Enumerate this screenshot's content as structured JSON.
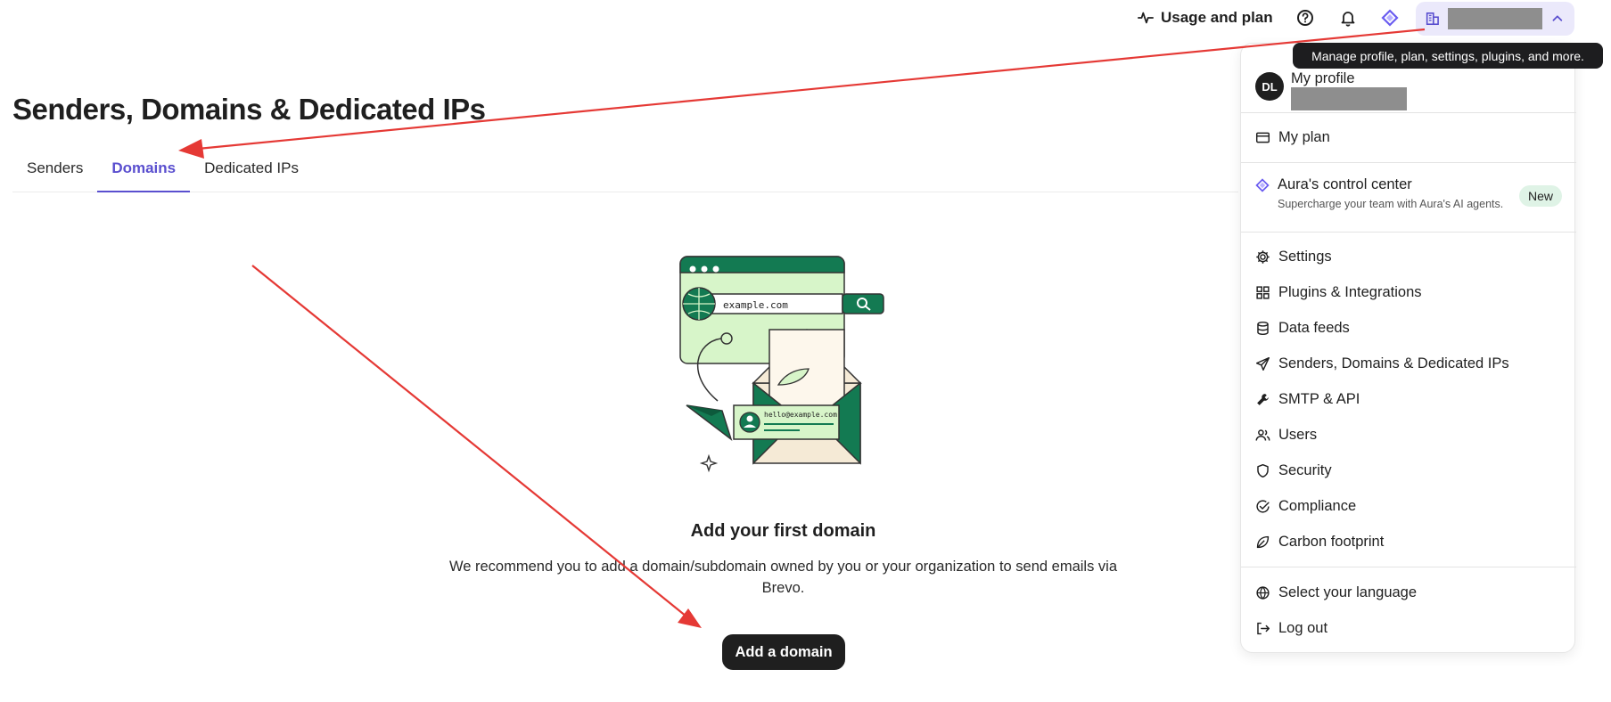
{
  "topbar": {
    "usage_label": "Usage and plan",
    "icons": [
      "pulse-icon",
      "help-icon",
      "bell-icon",
      "aura-diamond-icon",
      "building-icon",
      "chevron-up-icon"
    ]
  },
  "tooltip": "Manage profile, plan, settings, plugins, and more.",
  "page": {
    "title": "Senders, Domains & Dedicated IPs",
    "tabs": [
      {
        "label": "Senders",
        "active": false
      },
      {
        "label": "Domains",
        "active": true
      },
      {
        "label": "Dedicated IPs",
        "active": false
      }
    ]
  },
  "illustration": {
    "url_text": "example.com",
    "email_text": "hello@example.com"
  },
  "empty_state": {
    "title": "Add your first domain",
    "description": "We recommend you to add a domain/subdomain owned by you or your organization to send emails via Brevo.",
    "button": "Add a domain"
  },
  "menu": {
    "avatar_initials": "DL",
    "profile_label": "My profile",
    "plan_label": "My plan",
    "aura": {
      "label": "Aura's control center",
      "sub": "Supercharge your team with Aura's AI agents.",
      "badge": "New"
    },
    "items": [
      {
        "label": "Settings",
        "icon": "gear-icon"
      },
      {
        "label": "Plugins & Integrations",
        "icon": "grid-icon"
      },
      {
        "label": "Data feeds",
        "icon": "database-icon"
      },
      {
        "label": "Senders, Domains & Dedicated IPs",
        "icon": "paper-plane-icon"
      },
      {
        "label": "SMTP & API",
        "icon": "wrench-icon"
      },
      {
        "label": "Users",
        "icon": "users-icon"
      },
      {
        "label": "Security",
        "icon": "shield-icon"
      },
      {
        "label": "Compliance",
        "icon": "check-circle-icon"
      },
      {
        "label": "Carbon footprint",
        "icon": "leaf-icon"
      }
    ],
    "language_label": "Select your language",
    "logout_label": "Log out"
  },
  "colors": {
    "accent": "#5a4fcf",
    "annotation_red": "#e53935",
    "illustration_green": "#137a52",
    "illustration_light": "#d7f5c9"
  }
}
